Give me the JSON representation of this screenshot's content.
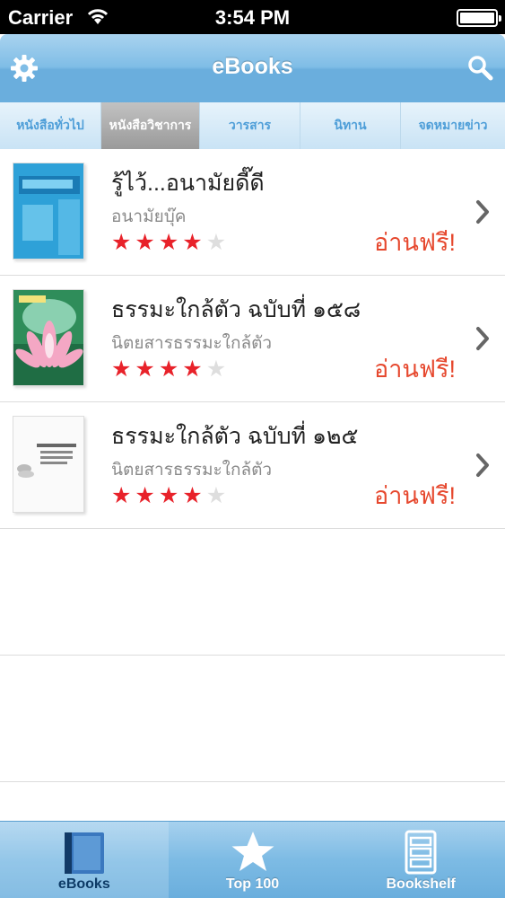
{
  "status_bar": {
    "carrier": "Carrier",
    "time": "3:54 PM"
  },
  "nav": {
    "title": "eBooks"
  },
  "tabs": [
    {
      "label": "หนังสือทั่วไป"
    },
    {
      "label": "หนังสือวิชาการ",
      "active": true
    },
    {
      "label": "วารสาร"
    },
    {
      "label": "นิทาน"
    },
    {
      "label": "จดหมายข่าว"
    }
  ],
  "books": [
    {
      "title": "รู้ไว้...อนามัยดี๊ดี",
      "publisher": "อนามัยบุ๊ค",
      "rating": 4,
      "price_label": "อ่านฟรี!"
    },
    {
      "title": "ธรรมะใกล้ตัว ฉบับที่ ๑๕๘",
      "publisher": "นิตยสารธรรมะใกล้ตัว",
      "rating": 4,
      "price_label": "อ่านฟรี!"
    },
    {
      "title": "ธรรมะใกล้ตัว ฉบับที่ ๑๒๕",
      "publisher": "นิตยสารธรรมะใกล้ตัว",
      "rating": 4,
      "price_label": "อ่านฟรี!"
    }
  ],
  "tab_bar": {
    "items": [
      {
        "label": "eBooks",
        "icon": "book-icon",
        "active": true
      },
      {
        "label": "Top 100",
        "icon": "star-icon"
      },
      {
        "label": "Bookshelf",
        "icon": "bookshelf-icon"
      }
    ]
  },
  "colors": {
    "accent": "#6aaedd",
    "price": "#e6482e",
    "star": "#e8222a"
  }
}
